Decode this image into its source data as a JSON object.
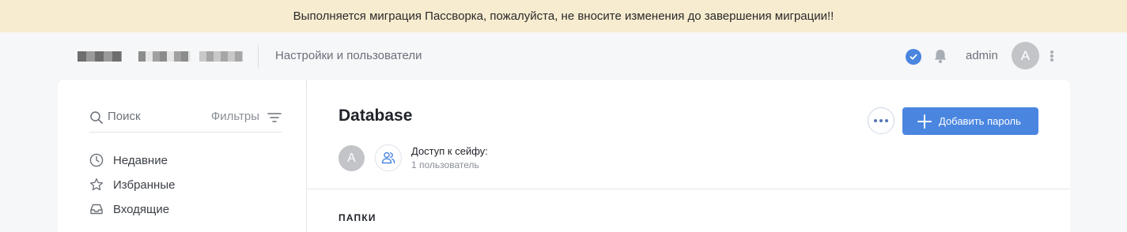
{
  "banner": {
    "message": "Выполняется миграция Пассворка, пожалуйста, не вносите изменения до завершения миграции!!",
    "background": "#f8ecd0"
  },
  "header": {
    "logo": "redacted-logo",
    "section_title": "Настройки и пользователи",
    "status_icon": "check-circle-icon",
    "notifications_icon": "bell-icon",
    "username": "admin",
    "avatar_initial": "A",
    "menu_icon": "vertical-dots-icon"
  },
  "sidebar": {
    "search_placeholder": "Поиск",
    "filters_label": "Фильтры",
    "items": [
      {
        "label": "Недавние",
        "icon": "clock-icon"
      },
      {
        "label": "Избранные",
        "icon": "star-icon"
      },
      {
        "label": "Входящие",
        "icon": "inbox-icon"
      }
    ]
  },
  "vault": {
    "title": "Database",
    "more_icon": "horizontal-dots-icon",
    "add_password_label": "Добавить пароль",
    "owner_initial": "A",
    "access_label": "Доступ к сейфу:",
    "access_count": "1 пользователь",
    "folders_heading": "ПАПКИ"
  },
  "colors": {
    "accent": "#4a86e0",
    "page_background": "#f6f7f9",
    "avatar": "#c2c4c8"
  }
}
